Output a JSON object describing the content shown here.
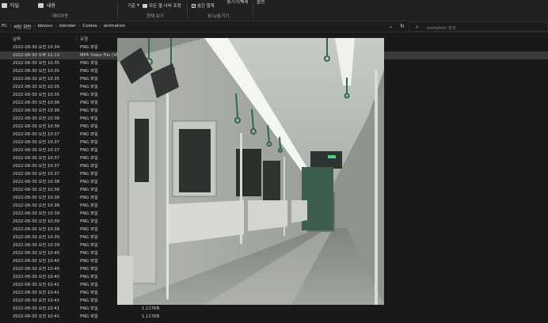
{
  "ribbon": {
    "pane_items": [
      "타일",
      "내용"
    ],
    "pane_label": "레이아웃",
    "sort_label": "기준",
    "fit_columns_label": "모든 열 너비 조정",
    "view_label": "현재 보기",
    "item_checkbox_label": "숨긴 항목",
    "item_checkbox_checked": true,
    "hide_selected_label": "숨기기/해제",
    "showhide_label": "표시/숨기기",
    "options_label": "옵션"
  },
  "address": {
    "crumbs": [
      "PC",
      "바탕 화면",
      "bbssvv",
      "blender",
      "Coloso",
      "animation"
    ],
    "search_placeholder": "animation 검색"
  },
  "columns": {
    "date": "날짜",
    "type": "유형"
  },
  "rows": [
    {
      "date": "2022-08-30 오전 10:34",
      "type": "PNG 파일",
      "size": ""
    },
    {
      "date": "2022-08-30 오후 12:13",
      "type": "MP4 Video File (VLC)",
      "size": "",
      "selected": true
    },
    {
      "date": "2022-08-30 오전 10:35",
      "type": "PNG 파일",
      "size": ""
    },
    {
      "date": "2022-08-30 오전 10:35",
      "type": "PNG 파일",
      "size": ""
    },
    {
      "date": "2022-08-30 오전 10:35",
      "type": "PNG 파일",
      "size": ""
    },
    {
      "date": "2022-08-30 오전 10:35",
      "type": "PNG 파일",
      "size": ""
    },
    {
      "date": "2022-08-30 오전 10:35",
      "type": "PNG 파일",
      "size": ""
    },
    {
      "date": "2022-08-30 오전 10:36",
      "type": "PNG 파일",
      "size": ""
    },
    {
      "date": "2022-08-30 오전 10:36",
      "type": "PNG 파일",
      "size": ""
    },
    {
      "date": "2022-08-30 오전 10:36",
      "type": "PNG 파일",
      "size": ""
    },
    {
      "date": "2022-08-30 오전 10:36",
      "type": "PNG 파일",
      "size": ""
    },
    {
      "date": "2022-08-30 오전 10:37",
      "type": "PNG 파일",
      "size": ""
    },
    {
      "date": "2022-08-30 오전 10:37",
      "type": "PNG 파일",
      "size": ""
    },
    {
      "date": "2022-08-30 오전 10:37",
      "type": "PNG 파일",
      "size": ""
    },
    {
      "date": "2022-08-30 오전 10:37",
      "type": "PNG 파일",
      "size": ""
    },
    {
      "date": "2022-08-30 오전 10:37",
      "type": "PNG 파일",
      "size": ""
    },
    {
      "date": "2022-08-30 오전 10:37",
      "type": "PNG 파일",
      "size": ""
    },
    {
      "date": "2022-08-30 오전 10:38",
      "type": "PNG 파일",
      "size": ""
    },
    {
      "date": "2022-08-30 오전 10:38",
      "type": "PNG 파일",
      "size": ""
    },
    {
      "date": "2022-08-30 오전 10:38",
      "type": "PNG 파일",
      "size": ""
    },
    {
      "date": "2022-08-30 오전 10:38",
      "type": "PNG 파일",
      "size": ""
    },
    {
      "date": "2022-08-30 오전 10:39",
      "type": "PNG 파일",
      "size": ""
    },
    {
      "date": "2022-08-30 오전 10:39",
      "type": "PNG 파일",
      "size": ""
    },
    {
      "date": "2022-08-30 오전 10:39",
      "type": "PNG 파일",
      "size": ""
    },
    {
      "date": "2022-08-30 오전 10:39",
      "type": "PNG 파일",
      "size": ""
    },
    {
      "date": "2022-08-30 오전 10:39",
      "type": "PNG 파일",
      "size": ""
    },
    {
      "date": "2022-08-30 오전 10:40",
      "type": "PNG 파일",
      "size": ""
    },
    {
      "date": "2022-08-30 오전 10:40",
      "type": "PNG 파일",
      "size": ""
    },
    {
      "date": "2022-08-30 오전 10:40",
      "type": "PNG 파일",
      "size": ""
    },
    {
      "date": "2022-08-30 오전 10:40",
      "type": "PNG 파일",
      "size": ""
    },
    {
      "date": "2022-08-30 오전 10:41",
      "type": "PNG 파일",
      "size": ""
    },
    {
      "date": "2022-08-30 오전 10:41",
      "type": "PNG 파일",
      "size": ""
    },
    {
      "date": "2022-08-30 오전 10:41",
      "type": "PNG 파일",
      "size": ""
    },
    {
      "date": "2022-08-30 오전 10:41",
      "type": "PNG 파일",
      "size": "1,117KB"
    },
    {
      "date": "2022-08-30 오전 10:41",
      "type": "PNG 파일",
      "size": "1,117KB"
    }
  ],
  "colors": {
    "background": "#191919",
    "ribbon": "#202020",
    "selected_row": "#3a3a3a"
  }
}
